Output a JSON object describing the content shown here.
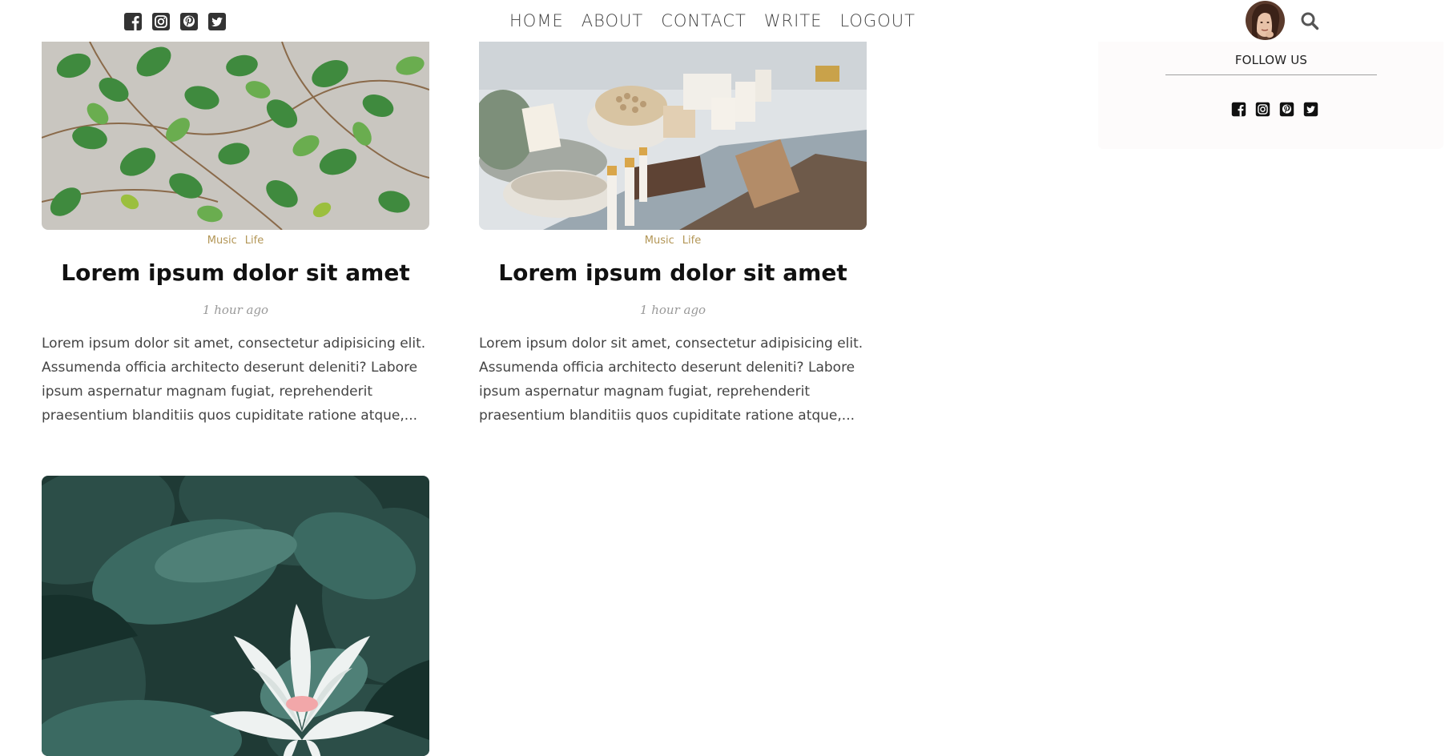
{
  "header": {
    "social": [
      {
        "icon": "facebook-icon"
      },
      {
        "icon": "instagram-icon"
      },
      {
        "icon": "pinterest-icon"
      },
      {
        "icon": "twitter-icon"
      }
    ],
    "nav": [
      "HOME",
      "ABOUT",
      "CONTACT",
      "WRITE",
      "LOGOUT"
    ],
    "avatar_icon": "user-avatar",
    "search_icon": "search-icon"
  },
  "posts": [
    {
      "image": "green-ivy-leaves-on-wall",
      "categories": [
        "Music",
        "Life"
      ],
      "title": "Lorem ipsum dolor sit amet",
      "date": "1 hour ago",
      "description": "Lorem ipsum dolor sit amet, consectetur adipisicing elit. Assumenda officia architecto deserunt deleniti? Labore ipsum aspernatur magnam fugiat, reprehenderit praesentium blanditiis quos cupiditate ratione atque,..."
    },
    {
      "image": "spa-products-on-shelf",
      "categories": [
        "Music",
        "Life"
      ],
      "title": "Lorem ipsum dolor sit amet",
      "date": "1 hour ago",
      "description": "Lorem ipsum dolor sit amet, consectetur adipisicing elit. Assumenda officia architecto deserunt deleniti? Labore ipsum aspernatur magnam fugiat, reprehenderit praesentium blanditiis quos cupiditate ratione atque,..."
    },
    {
      "image": "white-water-lily-among-leaves"
    }
  ],
  "sidebar": {
    "follow_title": "FOLLOW US",
    "social": [
      {
        "icon": "facebook-icon"
      },
      {
        "icon": "instagram-icon"
      },
      {
        "icon": "pinterest-icon"
      },
      {
        "icon": "twitter-icon"
      }
    ]
  },
  "colors": {
    "category": "#b39656",
    "text": "#444444",
    "sidebar_bg": "#fdfbfb"
  }
}
